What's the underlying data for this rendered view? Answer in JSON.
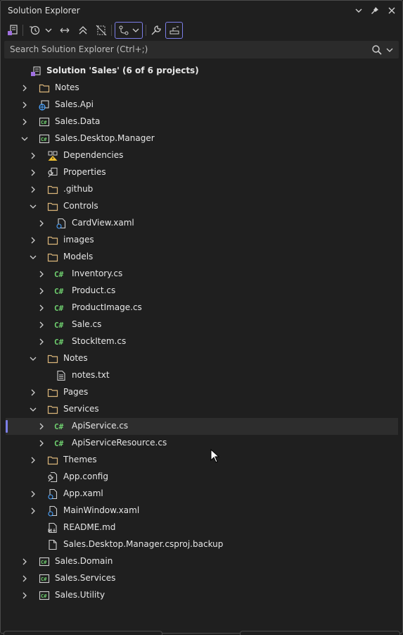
{
  "window": {
    "title": "Solution Explorer"
  },
  "search": {
    "placeholder": "Search Solution Explorer (Ctrl+;)"
  },
  "tree": [
    {
      "label": "Solution 'Sales' (6 of 6 projects)",
      "depth": 0,
      "icon": "solution-icon",
      "chevron": "none",
      "bold": true
    },
    {
      "label": "Notes",
      "depth": 1,
      "icon": "folder-icon",
      "chevron": "right"
    },
    {
      "label": "Sales.Api",
      "depth": 1,
      "icon": "web-project-icon",
      "chevron": "right"
    },
    {
      "label": "Sales.Data",
      "depth": 1,
      "icon": "csharp-project-icon",
      "chevron": "right"
    },
    {
      "label": "Sales.Desktop.Manager",
      "depth": 1,
      "icon": "csharp-project-icon",
      "chevron": "down"
    },
    {
      "label": "Dependencies",
      "depth": 2,
      "icon": "dependencies-warning-icon",
      "chevron": "right"
    },
    {
      "label": "Properties",
      "depth": 2,
      "icon": "properties-icon",
      "chevron": "right"
    },
    {
      "label": ".github",
      "depth": 2,
      "icon": "folder-icon",
      "chevron": "right"
    },
    {
      "label": "Controls",
      "depth": 2,
      "icon": "folder-icon",
      "chevron": "down"
    },
    {
      "label": "CardView.xaml",
      "depth": 3,
      "icon": "xaml-file-icon",
      "chevron": "right"
    },
    {
      "label": "images",
      "depth": 2,
      "icon": "folder-icon",
      "chevron": "right"
    },
    {
      "label": "Models",
      "depth": 2,
      "icon": "folder-icon",
      "chevron": "down"
    },
    {
      "label": "Inventory.cs",
      "depth": 3,
      "icon": "csharp-file-icon",
      "chevron": "right"
    },
    {
      "label": "Product.cs",
      "depth": 3,
      "icon": "csharp-file-icon",
      "chevron": "right"
    },
    {
      "label": "ProductImage.cs",
      "depth": 3,
      "icon": "csharp-file-icon",
      "chevron": "right"
    },
    {
      "label": "Sale.cs",
      "depth": 3,
      "icon": "csharp-file-icon",
      "chevron": "right"
    },
    {
      "label": "StockItem.cs",
      "depth": 3,
      "icon": "csharp-file-icon",
      "chevron": "right"
    },
    {
      "label": "Notes",
      "depth": 2,
      "icon": "folder-icon",
      "chevron": "down"
    },
    {
      "label": "notes.txt",
      "depth": 3,
      "icon": "text-file-icon",
      "chevron": "none"
    },
    {
      "label": "Pages",
      "depth": 2,
      "icon": "folder-icon",
      "chevron": "right"
    },
    {
      "label": "Services",
      "depth": 2,
      "icon": "folder-icon",
      "chevron": "down"
    },
    {
      "label": "ApiService.cs",
      "depth": 3,
      "icon": "csharp-file-icon",
      "chevron": "right",
      "selected": true
    },
    {
      "label": "ApiServiceResource.cs",
      "depth": 3,
      "icon": "csharp-file-icon",
      "chevron": "right"
    },
    {
      "label": "Themes",
      "depth": 2,
      "icon": "folder-icon",
      "chevron": "right"
    },
    {
      "label": "App.config",
      "depth": 2,
      "icon": "config-file-icon",
      "chevron": "none"
    },
    {
      "label": "App.xaml",
      "depth": 2,
      "icon": "xaml-file-icon",
      "chevron": "right"
    },
    {
      "label": "MainWindow.xaml",
      "depth": 2,
      "icon": "xaml-file-icon",
      "chevron": "right"
    },
    {
      "label": "README.md",
      "depth": 2,
      "icon": "markdown-file-icon",
      "chevron": "none"
    },
    {
      "label": "Sales.Desktop.Manager.csproj.backup",
      "depth": 2,
      "icon": "generic-file-icon",
      "chevron": "none"
    },
    {
      "label": "Sales.Domain",
      "depth": 1,
      "icon": "csharp-project-icon",
      "chevron": "right"
    },
    {
      "label": "Sales.Services",
      "depth": 1,
      "icon": "csharp-project-icon",
      "chevron": "right"
    },
    {
      "label": "Sales.Utility",
      "depth": 1,
      "icon": "csharp-project-icon",
      "chevron": "right"
    }
  ],
  "colors": {
    "background": "#1f1f1f",
    "accent": "#7c7fe8",
    "folder": "#dcb67a",
    "csharp": "#6fcf6f",
    "selected": "#2d2d2d"
  }
}
